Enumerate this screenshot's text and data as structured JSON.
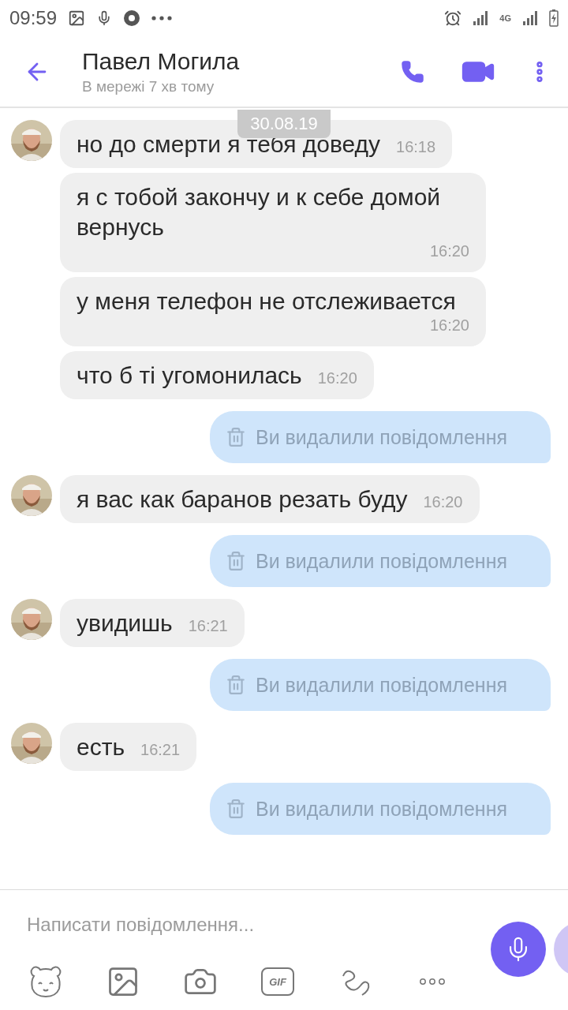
{
  "status_bar": {
    "time": "09:59",
    "network": "4G"
  },
  "header": {
    "title": "Павел Могила",
    "subtitle": "В мережі 7 хв тому"
  },
  "date_badge": "30.08.19",
  "messages": [
    {
      "kind": "incoming",
      "text": "но до смерти я тебя доведу",
      "time": "16:18"
    },
    {
      "kind": "incoming",
      "text": "я с тобой закончу и к себе домой вернусь",
      "time": "16:20"
    },
    {
      "kind": "incoming",
      "text": "у меня телефон не отслеживается",
      "time": "16:20"
    },
    {
      "kind": "incoming",
      "text": "что б ті угомонилась",
      "time": "16:20"
    },
    {
      "kind": "deleted",
      "text": "Ви видалили повідомлення"
    },
    {
      "kind": "incoming",
      "text": "я вас как баранов резать буду",
      "time": "16:20"
    },
    {
      "kind": "deleted",
      "text": "Ви видалили повідомлення"
    },
    {
      "kind": "incoming",
      "text": "увидишь",
      "time": "16:21"
    },
    {
      "kind": "deleted",
      "text": "Ви видалили повідомлення"
    },
    {
      "kind": "incoming",
      "text": "есть",
      "time": "16:21"
    },
    {
      "kind": "deleted",
      "text": "Ви видалили повідомлення"
    }
  ],
  "composer": {
    "placeholder": "Написати повідомлення...",
    "gif_label": "GIF"
  }
}
